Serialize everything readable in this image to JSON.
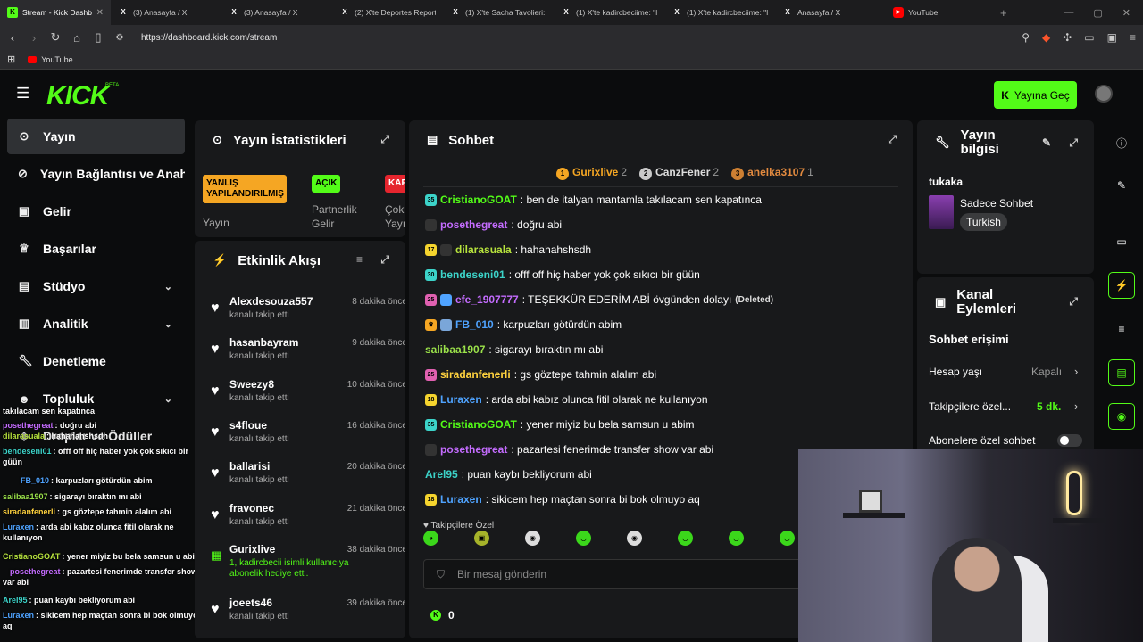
{
  "browser": {
    "tabs": [
      {
        "title": "Stream - Kick Dashbo",
        "icon": "kick-icon",
        "active": true
      },
      {
        "title": "(3) Anasayfa / X",
        "icon": "x-icon"
      },
      {
        "title": "(3) Anasayfa / X",
        "icon": "x-icon"
      },
      {
        "title": "(2) X'te Deportes Reports",
        "icon": "x-icon"
      },
      {
        "title": "(1) X'te Sacha Tavolieri: \"",
        "icon": "x-icon"
      },
      {
        "title": "(1) X'te kadircbeciime: \"htt",
        "icon": "x-icon"
      },
      {
        "title": "(1) X'te kadircbeciime: \"htt",
        "icon": "x-icon"
      },
      {
        "title": "Anasayfa / X",
        "icon": "x-icon"
      },
      {
        "title": "YouTube",
        "icon": "youtube-icon"
      }
    ],
    "url": "https://dashboard.kick.com/stream",
    "bookmark": "YouTube"
  },
  "topbar": {
    "logo": "KICK",
    "beta": "BETA",
    "go_live": "Yayına Geç"
  },
  "sidebar": {
    "items": [
      {
        "label": "Yayın",
        "icon": "broadcast-icon"
      },
      {
        "label": "Yayın Bağlantısı ve Anahtarı",
        "icon": "link-icon"
      },
      {
        "label": "Gelir",
        "icon": "income-icon"
      },
      {
        "label": "Başarılar",
        "icon": "trophy-icon"
      },
      {
        "label": "Stüdyo",
        "icon": "studio-icon"
      },
      {
        "label": "Analitik",
        "icon": "analytics-icon"
      },
      {
        "label": "Denetleme",
        "icon": "moderation-icon"
      },
      {
        "label": "Topluluk",
        "icon": "community-icon"
      },
      {
        "label": "Droplar ve Ödüller",
        "icon": "drops-icon"
      }
    ]
  },
  "overlay_chat": [
    {
      "user": "",
      "text": "takılacam sen kapatınca"
    },
    {
      "user": "posethegreat",
      "text": ": doğru abi"
    },
    {
      "user": "dilarasuala",
      "text": ": hahahahshsdh"
    },
    {
      "user": "bendeseni01",
      "text": ": offf off hiç haber yok çok sıkıcı bir güün"
    },
    {
      "user": "FB_010",
      "text": ": karpuzları götürdün abim"
    },
    {
      "user": "salibaa1907",
      "text": ": sigarayı bıraktın mı abi"
    },
    {
      "user": "siradanfenerli",
      "text": ": gs göztepe tahmin alalım abi"
    },
    {
      "user": "Luraxen",
      "text": ": arda abi kabız olunca fitil olarak ne kullanıyon"
    },
    {
      "user": "CristianoGOAT",
      "text": ": yener miyiz bu bela samsun u abim"
    },
    {
      "user": "posethegreat",
      "text": ": pazartesi fenerimde transfer show var abi"
    },
    {
      "user": "Arel95",
      "text": ": puan kaybı bekliyorum abi"
    },
    {
      "user": "Luraxen",
      "text": ": sikicem hep maçtan sonra bi bok olmuyo aq"
    }
  ],
  "stats": {
    "title": "Yayın İstatistikleri",
    "badges": [
      {
        "text": "YANLIŞ YAPILANDIRILMIŞ",
        "label": "Yayın"
      },
      {
        "text": "AÇIK",
        "label": "Partnerlik Gelir"
      },
      {
        "text": "KAP",
        "label": "Çok Yayı"
      }
    ]
  },
  "activity": {
    "title": "Etkinlik Akışı",
    "items": [
      {
        "name": "Alexdesouza557",
        "time": "8 dakika önce",
        "desc": "kanalı takip etti",
        "icon": "heart-icon"
      },
      {
        "name": "hasanbayram",
        "time": "9 dakika önce",
        "desc": "kanalı takip etti",
        "icon": "heart-icon"
      },
      {
        "name": "Sweezy8",
        "time": "10 dakika önce",
        "desc": "kanalı takip etti",
        "icon": "heart-icon"
      },
      {
        "name": "s4floue",
        "time": "16 dakika önce",
        "desc": "kanalı takip etti",
        "icon": "heart-icon"
      },
      {
        "name": "ballarisi",
        "time": "20 dakika önce",
        "desc": "kanalı takip etti",
        "icon": "heart-icon"
      },
      {
        "name": "fravonec",
        "time": "21 dakika önce",
        "desc": "kanalı takip etti",
        "icon": "heart-icon"
      },
      {
        "name": "Gurixlive",
        "time": "38 dakika önce",
        "desc": "1, kadircbecii isimli kullanıcıya abonelik hediye etti.",
        "icon": "gift-icon"
      },
      {
        "name": "joeets46",
        "time": "39 dakika önce",
        "desc": "kanalı takip etti",
        "icon": "heart-icon"
      }
    ]
  },
  "chat": {
    "title": "Sohbet",
    "top": [
      {
        "rank": "1",
        "name": "Gurixlive",
        "count": "2"
      },
      {
        "rank": "2",
        "name": "CanzFener",
        "count": "2"
      },
      {
        "rank": "3",
        "name": "anelka3107",
        "count": "1"
      }
    ],
    "messages": [
      {
        "badge": "35",
        "user": "CristianoGOAT",
        "text": ": ben de italyan mantamla takılacam sen kapatınca"
      },
      {
        "badge": "",
        "user": "posethegreat",
        "text": ": doğru abi"
      },
      {
        "badge": "17",
        "user": "dilarasuala",
        "text": ": hahahahshsdh"
      },
      {
        "badge": "30",
        "user": "bendeseni01",
        "text": ": offf off hiç haber yok çok sıkıcı bir güün"
      },
      {
        "badge": "25",
        "user": "efe_1907777",
        "text": ": TEŞEKKÜR EDERİM ABİ övgünden dolayı",
        "extra": "(Deleted)"
      },
      {
        "badge": "",
        "user": "FB_010",
        "text": ": karpuzları götürdün abim"
      },
      {
        "badge": "",
        "user": "salibaa1907",
        "text": ": sigarayı bıraktın mı abi"
      },
      {
        "badge": "25",
        "user": "siradanfenerli",
        "text": ": gs göztepe tahmin alalım abi"
      },
      {
        "badge": "18",
        "user": "Luraxen",
        "text": ": arda abi kabız olunca fitil olarak ne kullanıyon"
      },
      {
        "badge": "35",
        "user": "CristianoGOAT",
        "text": ": yener miyiz bu bela samsun u abim"
      },
      {
        "badge": "",
        "user": "posethegreat",
        "text": ": pazartesi fenerimde transfer show var abi"
      },
      {
        "badge": "",
        "user": "Arel95",
        "text": ": puan kaybı bekliyorum abi"
      },
      {
        "badge": "18",
        "user": "Luraxen",
        "text": ": sikicem hep maçtan sonra bi bok olmuyo aq"
      }
    ],
    "followers_only": "Takipçilere Özel",
    "placeholder": "Bir mesaj gönderin",
    "points": "0"
  },
  "stream_info": {
    "title": "Yayın bilgisi",
    "channel": "tukaka",
    "category": "Sadece Sohbet",
    "language": "Turkish"
  },
  "channel_actions": {
    "title": "Kanal Eylemleri",
    "section": "Sohbet erişimi",
    "rows": [
      {
        "label": "Hesap yaşı",
        "value": "Kapalı"
      },
      {
        "label": "Takipçilere özel...",
        "value": "5 dk."
      },
      {
        "label": "Abonelere özel sohbet",
        "value": ""
      }
    ]
  },
  "colors": {
    "accent": "#53fc18",
    "panel": "#18191b",
    "badge_warning": "#f5a623"
  }
}
